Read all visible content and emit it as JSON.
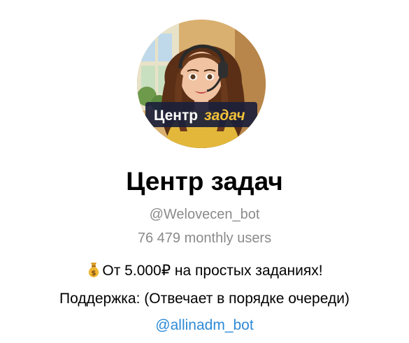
{
  "bot": {
    "name": "Центр задач",
    "username": "@Welovecen_bot",
    "monthly_users": "76 479 monthly users",
    "avatar_caption_left": "Центр",
    "avatar_caption_right": "задач"
  },
  "description": {
    "line1_icon": "moneybag-icon",
    "line1": "От 5.000₽ на простых заданиях!",
    "line2": "Поддержка: (Отвечает в порядке очереди)",
    "support_link": "@allinadm_bot"
  },
  "colors": {
    "link": "#2e8ad6",
    "secondary_text": "#8a8a8a",
    "primary_text": "#000000"
  }
}
